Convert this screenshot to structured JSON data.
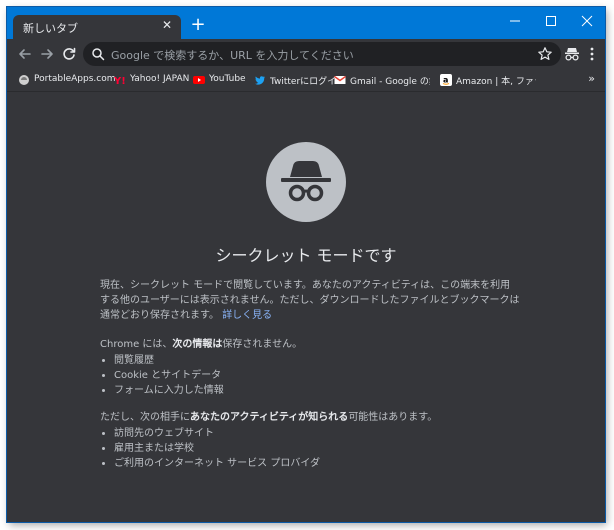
{
  "tab": {
    "title": "新しいタブ",
    "close": "✕"
  },
  "new_tab": "+",
  "window_controls": {
    "minimize": "—",
    "maximize": "☐",
    "close": "✕"
  },
  "toolbar": {
    "back_icon": "arrow-left-icon",
    "forward_icon": "arrow-right-icon",
    "reload_icon": "reload-icon",
    "omnibox_placeholder": "Google で検索するか、URL を入力してください"
  },
  "bookmarks": [
    {
      "label": "PortableApps.com",
      "icon": "portableapps-icon",
      "color": "#cfcfcf"
    },
    {
      "label": "Yahoo! JAPAN",
      "icon": "yahoo-icon",
      "color": "#ff0033"
    },
    {
      "label": "YouTube",
      "icon": "youtube-icon",
      "color": "#ff0000"
    },
    {
      "label": "Twitterにログイン",
      "icon": "twitter-icon",
      "color": "#1da1f2"
    },
    {
      "label": "Gmail - Google の無料",
      "icon": "gmail-icon",
      "color": "#ea4335"
    },
    {
      "label": "Amazon | 本, ファッショ",
      "icon": "amazon-icon",
      "color": "#ffffff"
    }
  ],
  "bookmarks_more": "»",
  "main": {
    "heading": "シークレット モードです",
    "intro": "現在、シークレット モードで閲覧しています。あなたのアクティビティは、この端末を利用する他のユーザーには表示されません。ただし、ダウンロードしたファイルとブックマークは通常どおり保存されます。",
    "learn_more": "詳しく見る",
    "section1_pre": "Chrome には、",
    "section1_bold": "次の情報は",
    "section1_post": "保存されません。",
    "section1_items": [
      "閲覧履歴",
      "Cookie とサイトデータ",
      "フォームに入力した情報"
    ],
    "section2_pre": "ただし、次の相手に",
    "section2_bold": "あなたのアクティビティが知られる",
    "section2_post": "可能性はあります。",
    "section2_items": [
      "訪問先のウェブサイト",
      "雇用主または学校",
      "ご利用のインターネット サービス プロバイダ"
    ]
  },
  "colors": {
    "titlebar": "#0078d7",
    "background": "#35363a",
    "link": "#8ab4f8"
  }
}
